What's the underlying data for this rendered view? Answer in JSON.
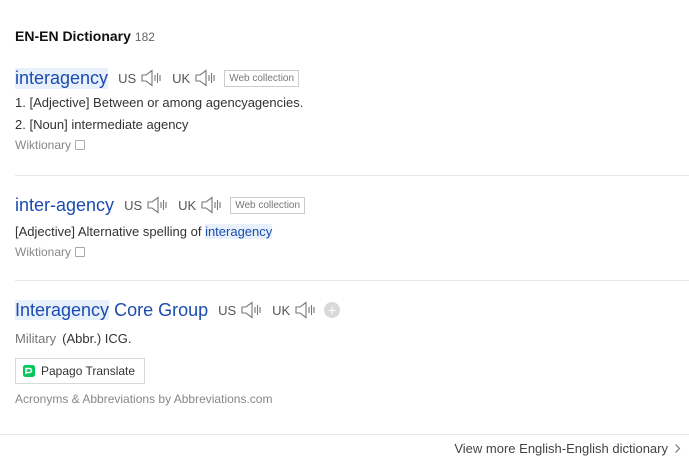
{
  "section": {
    "title": "EN-EN Dictionary",
    "count": "182"
  },
  "entries": [
    {
      "term": "interagency",
      "pron": {
        "us": "US",
        "uk": "UK"
      },
      "badge": "Web collection",
      "defs": [
        "1. [Adjective] Between or among agencyagencies.",
        "2. [Noun] intermediate agency"
      ],
      "source": "Wiktionary"
    },
    {
      "term": "inter-agency",
      "pron": {
        "us": "US",
        "uk": "UK"
      },
      "badge": "Web collection",
      "def_prefix": "[Adjective] Alternative spelling of",
      "def_link": "interagency",
      "source": "Wiktionary"
    },
    {
      "term_hl": "Interagency",
      "term_rest": " Core Group",
      "pron": {
        "us": "US",
        "uk": "UK"
      },
      "plus": "+",
      "category": "Military",
      "def": "(Abbr.) ICG.",
      "translate_label": "Papago Translate",
      "source": "Acronyms & Abbreviations by Abbreviations.com"
    }
  ],
  "footer": {
    "more_link": "View more English-English dictionary"
  },
  "colors": {
    "term_link": "#1b4bb0",
    "highlight": "#e8f1fb",
    "papago_green": "#03c75a"
  },
  "icons": {
    "speaker": "speaker-icon",
    "copy": "copy-icon",
    "plus": "plus-icon",
    "chevron": "chevron-right-icon",
    "papago": "papago-logo-icon"
  }
}
